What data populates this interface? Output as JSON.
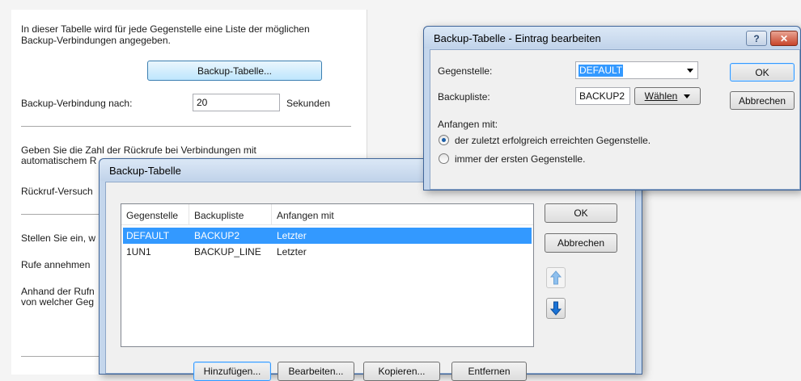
{
  "panel": {
    "intro_line1": "In dieser Tabelle wird für jede Gegenstelle eine Liste der möglichen",
    "intro_line2": "Backup-Verbindungen angegeben.",
    "backup_table_button": "Backup-Tabelle...",
    "backup_after_label": "Backup-Verbindung nach:",
    "backup_after_value": "20",
    "backup_after_unit": "Sekunden",
    "callback_line1": "Geben Sie die Zahl der Rückrufe bei Verbindungen mit",
    "callback_line2": "automatischem R",
    "callback_attempts_label": "Rückruf-Versuch",
    "set_label": "Stellen Sie ein, w",
    "accept_calls_label": "Rufe annehmen",
    "based_on_line1": "Anhand der Rufn",
    "based_on_line2": "von welcher Geg"
  },
  "edit_dialog": {
    "title": "Backup-Tabelle - Eintrag bearbeiten",
    "help_label": "?",
    "close_label": "✕",
    "peer_label": "Gegenstelle:",
    "peer_value": "DEFAULT",
    "backup_list_label": "Backupliste:",
    "backup_list_value": "BACKUP2",
    "choose_button": "Wählen",
    "start_with_label": "Anfangen mit:",
    "radio_last": "der zuletzt erfolgreich erreichten Gegenstelle.",
    "radio_first": "immer der ersten Gegenstelle.",
    "ok_button": "OK",
    "cancel_button": "Abbrechen"
  },
  "table_dialog": {
    "title": "Backup-Tabelle",
    "columns": [
      "Gegenstelle",
      "Backupliste",
      "Anfangen mit"
    ],
    "rows": [
      {
        "peer": "DEFAULT",
        "list": "BACKUP2",
        "start": "Letzter",
        "selected": true
      },
      {
        "peer": "1UN1",
        "list": "BACKUP_LINE",
        "start": "Letzter",
        "selected": false
      }
    ],
    "ok_button": "OK",
    "cancel_button": "Abbrechen",
    "add_button": "Hinzufügen...",
    "edit_button": "Bearbeiten...",
    "copy_button": "Kopieren...",
    "remove_button": "Entfernen",
    "up_icon": "arrow-up-icon",
    "down_icon": "arrow-down-icon"
  },
  "colors": {
    "selection": "#3399ff",
    "dialog_frame": "#c4d6ec",
    "arrow_blue": "#1a73d6"
  }
}
